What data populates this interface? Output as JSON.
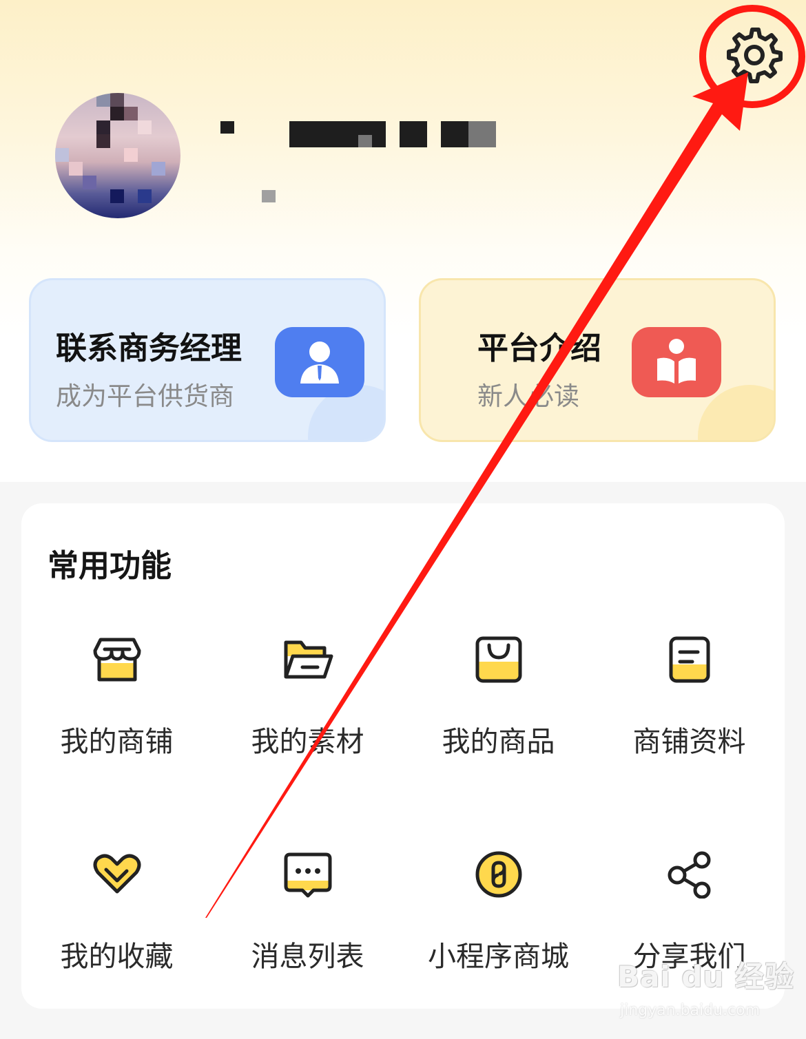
{
  "header": {
    "settings_icon": "gear-icon"
  },
  "cards": [
    {
      "title": "联系商务经理",
      "subtitle": "成为平台供货商",
      "icon": "business-manager-icon",
      "color": "#4f7ef0"
    },
    {
      "title": "平台介绍",
      "subtitle": "新人必读",
      "icon": "book-reader-icon",
      "color": "#ef5a54"
    }
  ],
  "functions": {
    "title": "常用功能",
    "items": [
      {
        "label": "我的商铺",
        "icon": "store-icon"
      },
      {
        "label": "我的素材",
        "icon": "folder-icon"
      },
      {
        "label": "我的商品",
        "icon": "shopping-bag-icon"
      },
      {
        "label": "商铺资料",
        "icon": "document-icon"
      },
      {
        "label": "我的收藏",
        "icon": "heart-icon"
      },
      {
        "label": "消息列表",
        "icon": "message-icon"
      },
      {
        "label": "小程序商城",
        "icon": "mini-program-icon"
      },
      {
        "label": "分享我们",
        "icon": "share-icon"
      }
    ]
  },
  "watermark": {
    "brand": "Bai du 经验",
    "url": "jingyan.baidu.com"
  },
  "colors": {
    "accent_yellow": "#ffd84d",
    "annotation_red": "#ff1a12"
  }
}
